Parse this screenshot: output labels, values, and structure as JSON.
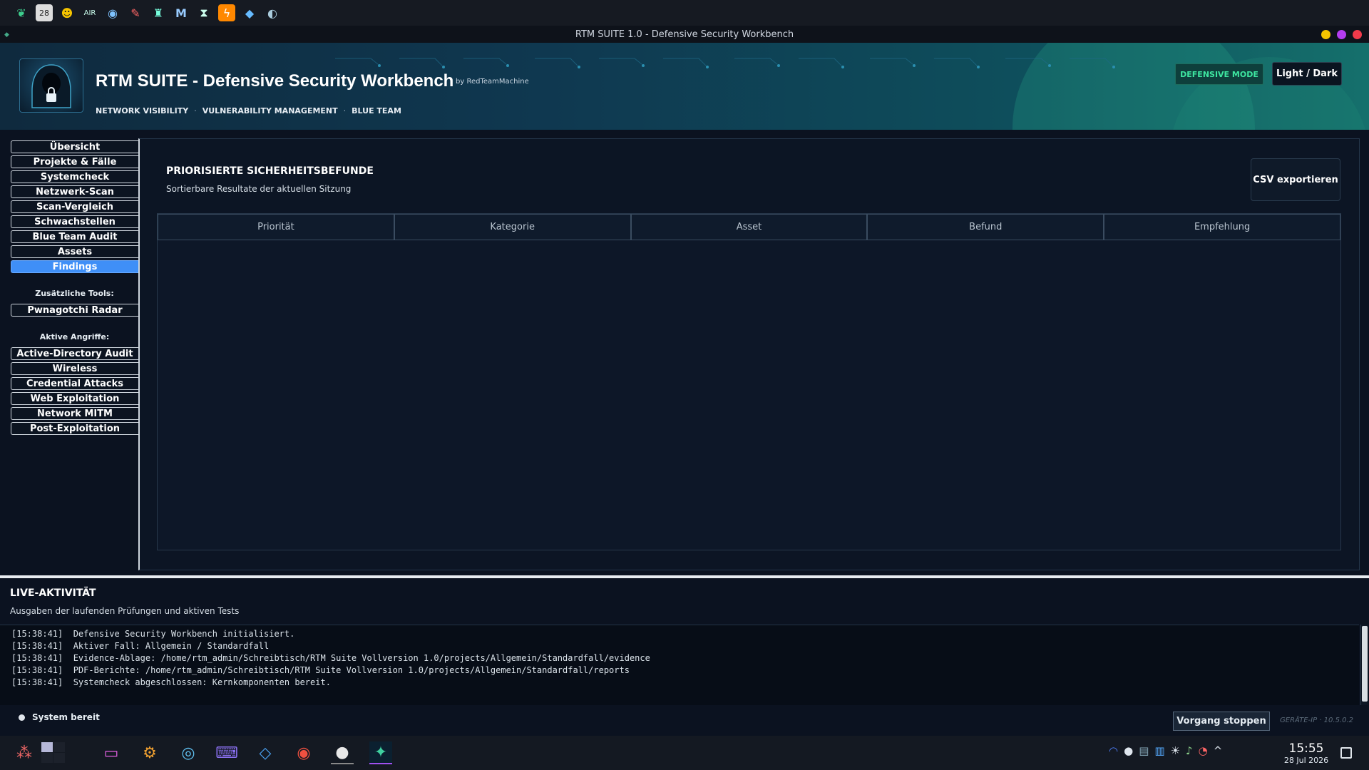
{
  "titlebar": {
    "title": "RTM SUITE 1.0 - Defensive Security Workbench"
  },
  "header": {
    "title": "RTM SUITE - Defensive Security Workbench",
    "byline": "by RedTeamMachine",
    "subnav": [
      "NETWORK VISIBILITY",
      "VULNERABILITY MANAGEMENT",
      "BLUE TEAM"
    ],
    "separator": "·",
    "mode_badge": "DEFENSIVE MODE",
    "theme_toggle": "Light / Dark"
  },
  "sidebar": {
    "items": [
      "Übersicht",
      "Projekte & Fälle",
      "Systemcheck",
      "Netzwerk-Scan",
      "Scan-Vergleich",
      "Schwachstellen",
      "Blue Team Audit",
      "Assets",
      "Findings"
    ],
    "active": "Findings",
    "extra_tools_label": "Zusätzliche Tools:",
    "extra_tools": [
      "Pwnagotchi Radar"
    ],
    "attacks_label": "Aktive Angriffe:",
    "attacks": [
      "Active-Directory Audit",
      "Wireless",
      "Credential Attacks",
      "Web Exploitation",
      "Network MITM",
      "Post-Exploitation"
    ]
  },
  "main": {
    "title": "PRIORISIERTE SICHERHEITSBEFUNDE",
    "subtitle": "Sortierbare Resultate der aktuellen Sitzung",
    "csv_button": "CSV exportieren",
    "columns": [
      "Priorität",
      "Kategorie",
      "Asset",
      "Befund",
      "Empfehlung"
    ]
  },
  "live": {
    "title": "LIVE-AKTIVITÄT",
    "subtitle": "Ausgaben der laufenden Prüfungen und aktiven Tests",
    "log": [
      "[15:38:41]  Defensive Security Workbench initialisiert.",
      "[15:38:41]  Aktiver Fall: Allgemein / Standardfall",
      "[15:38:41]  Evidence-Ablage: /home/rtm_admin/Schreibtisch/RTM Suite Vollversion 1.0/projects/Allgemein/Standardfall/evidence",
      "[15:38:41]  PDF-Berichte: /home/rtm_admin/Schreibtisch/RTM Suite Vollversion 1.0/projects/Allgemein/Standardfall/reports",
      "[15:38:41]  Systemcheck abgeschlossen: Kernkomponenten bereit."
    ],
    "status": "System bereit",
    "stop_button": "Vorgang stoppen",
    "device_ip": "GERÄTE-IP · 10.5.0.2"
  },
  "taskbar": {
    "time": "15:55",
    "date": "28 Jul 2026"
  },
  "colors": {
    "accent": "#3f8ff7",
    "mode_green": "#3ee6a1",
    "background": "#0b1220"
  }
}
